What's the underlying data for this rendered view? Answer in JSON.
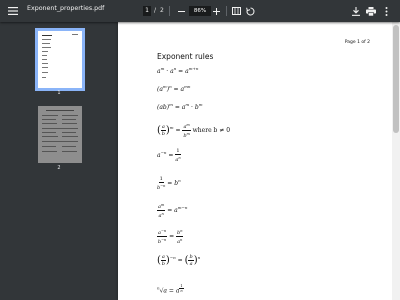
{
  "toolbar": {
    "title": "Exponent_properties.pdf",
    "current_page": "1",
    "separator": "/",
    "total_pages": "2",
    "zoom": "86%"
  },
  "sidebar": {
    "thumbnails": [
      {
        "label": "1",
        "selected": true
      },
      {
        "label": "2",
        "selected": false
      }
    ]
  },
  "document": {
    "page_label": "Page 1 of 2",
    "heading": "Exponent rules",
    "rule_product": "a^m · a^n = a^(m+n)",
    "rule_power_of_power": "(a^m)^n = a^(mn)",
    "rule_power_of_product": "(ab)^m = a^m · b^m",
    "rule_power_of_quotient_tail": "where b ≠ 0",
    "rule_negative": "a^(−n) = 1/a^n",
    "rule_reciprocal": "1/b^(−n) = b^n",
    "rule_quotient": "a^m/a^n = a^(m−n)",
    "rule_negative_quotient": "a^(−n)/b^(−n) = b^n/a^n",
    "rule_inverted_fraction": "(a/b)^(−n) = (b/a)^n",
    "rule_root": "ⁿ√a = a^(1/n)"
  },
  "colors": {
    "toolbar_bg": "#323639",
    "sidebar_bg": "#323639",
    "viewer_bg": "#525659",
    "selection": "#8ab4f8"
  },
  "icons": [
    "menu-icon",
    "minus-icon",
    "plus-icon",
    "fit-page-icon",
    "rotate-icon",
    "download-icon",
    "print-icon",
    "more-vert-icon"
  ]
}
